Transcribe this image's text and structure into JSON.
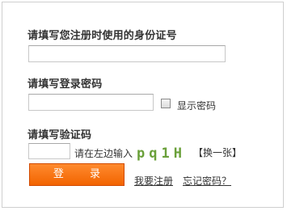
{
  "form": {
    "id_label": "请填写您注册时使用的身份证号",
    "id_value": "",
    "password_label": "请填写登录密码",
    "password_value": "",
    "show_password_label": "显示密码",
    "show_password_checked": false,
    "captcha_label": "请填写验证码",
    "captcha_value": "",
    "captcha_hint": "请在左边输入",
    "captcha_code": "pq1H",
    "refresh_label": "【换一张】",
    "login_label": "登 录",
    "register_link": "我要注册",
    "forgot_link": "忘记密码？"
  },
  "colors": {
    "button": "#f26400",
    "captcha": "#6aa03a",
    "border": "#cfcfcf"
  }
}
